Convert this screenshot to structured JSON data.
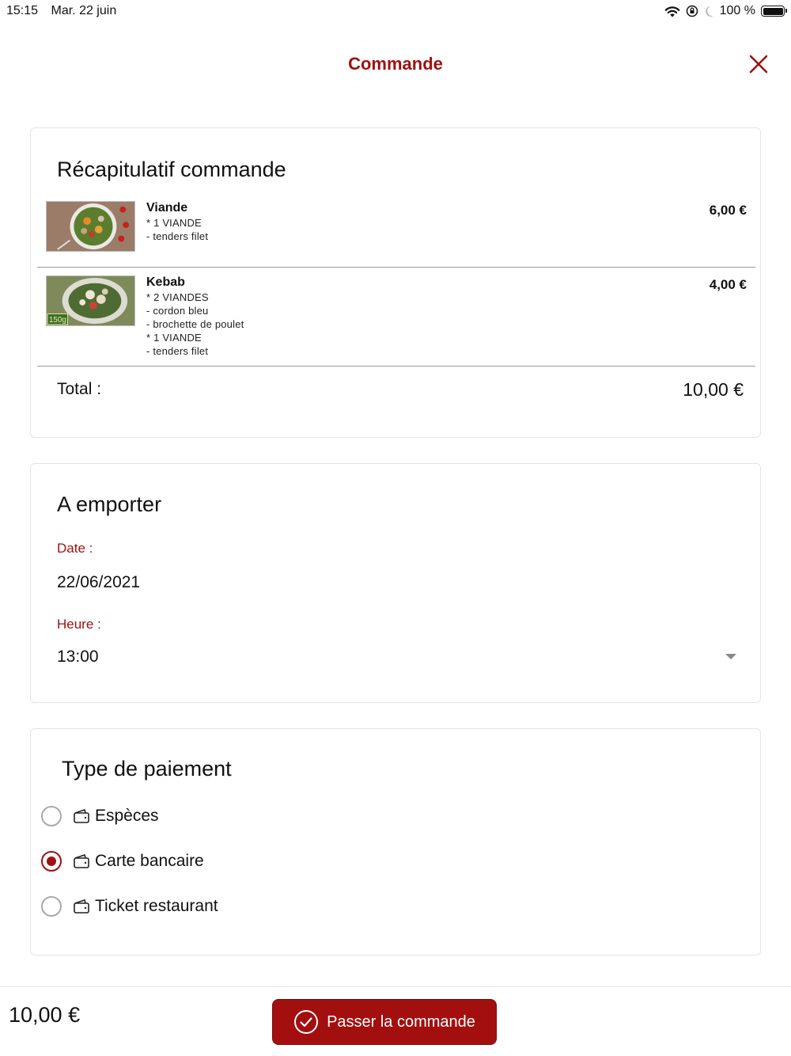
{
  "status_bar": {
    "time": "15:15",
    "date": "Mar. 22 juin",
    "battery": "100 %",
    "icons": [
      "wifi-icon",
      "orientation-lock-icon",
      "moon-icon",
      "battery-icon"
    ]
  },
  "header": {
    "title": "Commande",
    "close_icon": "close-icon"
  },
  "summary": {
    "title": "Récapitulatif commande",
    "items": [
      {
        "name": "Viande",
        "details": [
          "* 1 VIANDE",
          "- tenders filet"
        ],
        "price": "6,00 €"
      },
      {
        "name": "Kebab",
        "details": [
          "* 2 VIANDES",
          "- cordon bleu",
          "- brochette de poulet",
          "* 1 VIANDE",
          "- tenders filet"
        ],
        "price": "4,00 €",
        "image_badge": "150g"
      }
    ],
    "total_label": "Total :",
    "total_value": "10,00 €"
  },
  "takeaway": {
    "title": "A emporter",
    "date_label": "Date :",
    "date_value": "22/06/2021",
    "time_label": "Heure :",
    "time_value": "13:00"
  },
  "payment": {
    "title": "Type de paiement",
    "options": [
      {
        "label": "Espèces",
        "selected": false
      },
      {
        "label": "Carte bancaire",
        "selected": true
      },
      {
        "label": "Ticket restaurant",
        "selected": false
      }
    ]
  },
  "footer": {
    "total": "10,00 €",
    "order_button_label": "Passer la commande"
  },
  "colors": {
    "accent": "#9e1010",
    "button": "#a30f0f"
  }
}
